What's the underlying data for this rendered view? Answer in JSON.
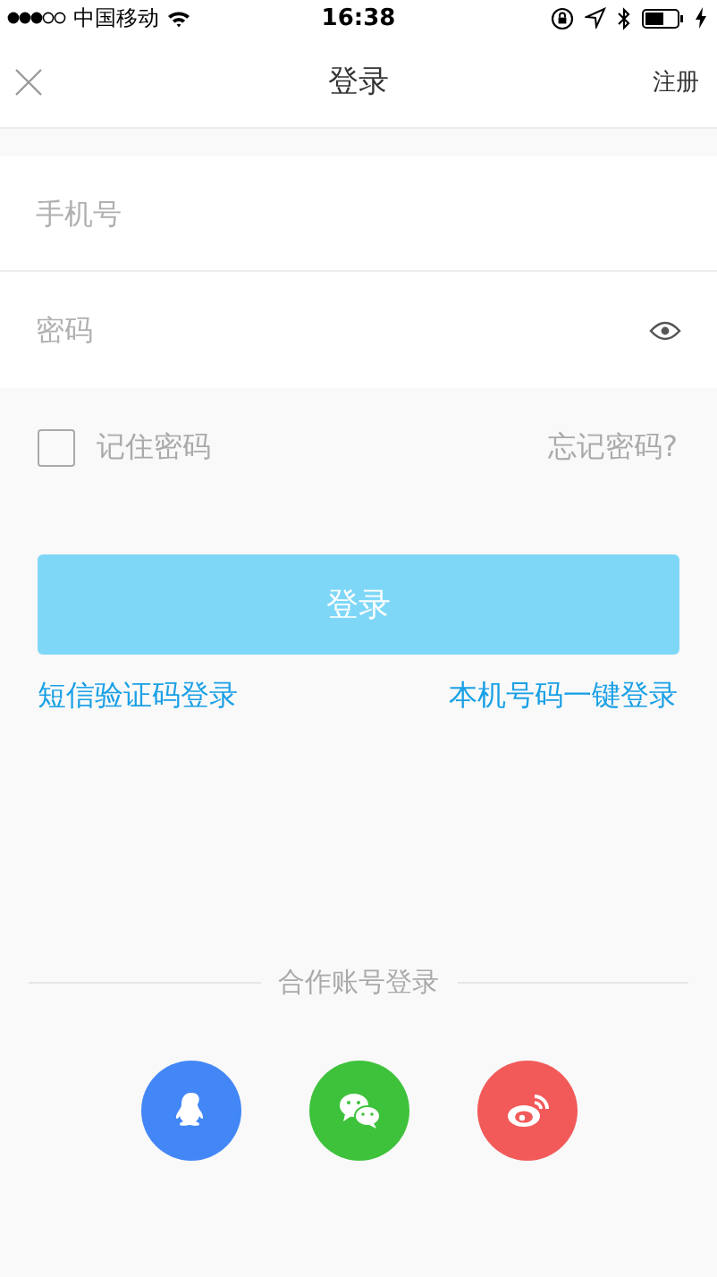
{
  "status_bar": {
    "carrier": "中国移动",
    "time": "16:38"
  },
  "nav": {
    "title": "登录",
    "action": "注册"
  },
  "fields": [
    {
      "kind": "phone",
      "placeholder": "手机号"
    },
    {
      "kind": "password",
      "placeholder": "密码"
    }
  ],
  "remember": {
    "label": "记住密码",
    "checked": false
  },
  "forgot": "忘记密码?",
  "login_button": {
    "label": "登录",
    "disabled": true
  },
  "links": [
    "短信验证码登录",
    "本机号码一键登录"
  ],
  "partner": {
    "title": "合作账号登录",
    "accounts": [
      {
        "kind": "qq",
        "color": "#4387f6"
      },
      {
        "kind": "wechat",
        "color": "#3ec23c"
      },
      {
        "kind": "weibo",
        "color": "#f25a5a"
      }
    ]
  }
}
